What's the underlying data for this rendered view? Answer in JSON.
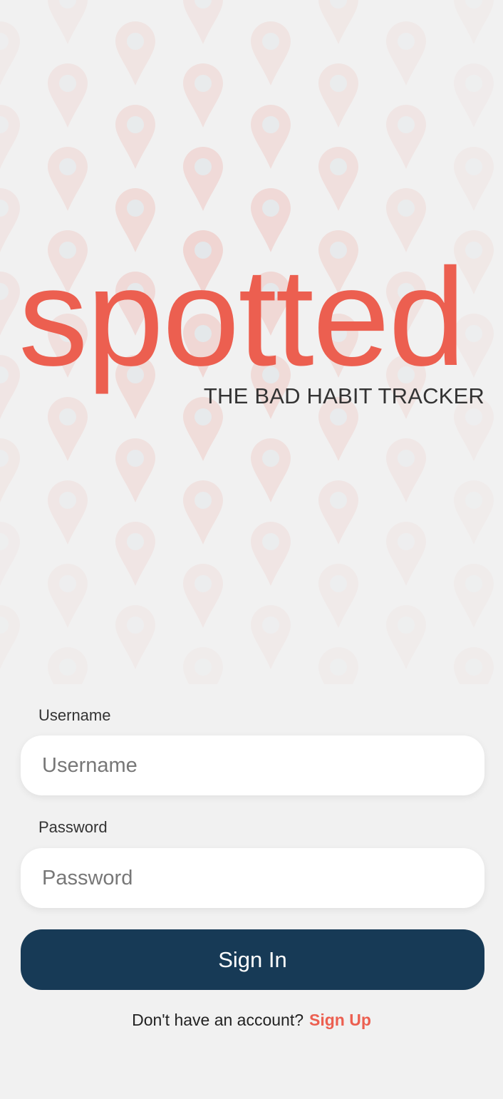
{
  "app": {
    "logo_text": "spotted",
    "tagline": "THE BAD HABIT TRACKER"
  },
  "form": {
    "username_label": "Username",
    "username_placeholder": "Username",
    "username_value": "",
    "password_label": "Password",
    "password_placeholder": "Password",
    "password_value": "",
    "signin_label": "Sign In"
  },
  "footer": {
    "prompt": "Don't have an account?",
    "signup_label": "Sign Up"
  },
  "colors": {
    "brand": "#ec5f50",
    "primary_button": "#173a56",
    "background": "#f1f1f1"
  },
  "icons": {
    "background_pattern": "map-pin-icon"
  }
}
